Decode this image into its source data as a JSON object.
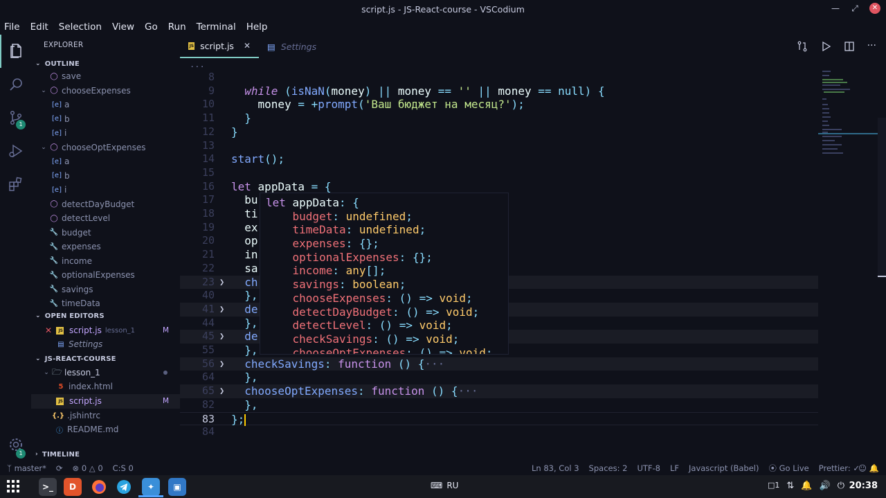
{
  "window": {
    "title": "script.js - JS-React-course - VSCodium"
  },
  "menu": [
    "File",
    "Edit",
    "Selection",
    "View",
    "Go",
    "Run",
    "Terminal",
    "Help"
  ],
  "activity": {
    "scm_badge": "1",
    "settings_badge": "1"
  },
  "sidebar": {
    "title": "EXPLORER",
    "outline_label": "OUTLINE",
    "outline_items": [
      {
        "label": "save",
        "kind": "method",
        "indent": 1
      },
      {
        "label": "chooseExpenses",
        "kind": "method",
        "indent": 1,
        "arrow": true
      },
      {
        "label": "a",
        "kind": "var",
        "indent": 2
      },
      {
        "label": "b",
        "kind": "var",
        "indent": 2
      },
      {
        "label": "i",
        "kind": "var",
        "indent": 2
      },
      {
        "label": "chooseOptExpenses",
        "kind": "method",
        "indent": 1,
        "arrow": true
      },
      {
        "label": "a",
        "kind": "var",
        "indent": 2
      },
      {
        "label": "b",
        "kind": "var",
        "indent": 2
      },
      {
        "label": "i",
        "kind": "var",
        "indent": 2
      },
      {
        "label": "detectDayBudget",
        "kind": "method",
        "indent": 1
      },
      {
        "label": "detectLevel",
        "kind": "method",
        "indent": 1
      },
      {
        "label": "budget",
        "kind": "prop",
        "indent": 1
      },
      {
        "label": "expenses",
        "kind": "prop",
        "indent": 1
      },
      {
        "label": "income",
        "kind": "prop",
        "indent": 1
      },
      {
        "label": "optionalExpenses",
        "kind": "prop",
        "indent": 1
      },
      {
        "label": "savings",
        "kind": "prop",
        "indent": 1
      },
      {
        "label": "timeData",
        "kind": "prop",
        "indent": 1
      }
    ],
    "open_editors_label": "OPEN EDITORS",
    "open_editors": [
      {
        "label": "script.js",
        "sub": "lesson_1",
        "flag": "M"
      },
      {
        "label": "Settings"
      }
    ],
    "project_label": "JS-REACT-COURSE",
    "files": [
      {
        "label": "lesson_1",
        "kind": "folder"
      },
      {
        "label": "index.html",
        "kind": "html"
      },
      {
        "label": "script.js",
        "kind": "js",
        "flag": "M"
      },
      {
        "label": ".jshintrc",
        "kind": "json"
      },
      {
        "label": "README.md",
        "kind": "info"
      }
    ],
    "timeline_label": "TIMELINE"
  },
  "tabs": [
    {
      "label": "script.js",
      "active": true
    },
    {
      "label": "Settings",
      "active": false
    }
  ],
  "editor": {
    "top_fold": "...",
    "lines": [
      {
        "n": "8",
        "html": ""
      },
      {
        "n": "9",
        "html": "  <span class=\"kwi\">while</span> <span class=\"op\">(</span><span class=\"fn\">isNaN</span><span class=\"op\">(</span><span class=\"var\">money</span><span class=\"op\">)</span> <span class=\"op\">||</span> <span class=\"var\">money</span> <span class=\"op\">==</span> <span class=\"str\">''</span> <span class=\"op\">||</span> <span class=\"var\">money</span> <span class=\"op\">==</span> <span class=\"op\">null)</span> <span class=\"op\">{</span>"
      },
      {
        "n": "10",
        "html": "    <span class=\"var\">money</span> <span class=\"op\">=</span> <span class=\"op\">+</span><span class=\"fn\">prompt</span><span class=\"op\">(</span><span class=\"str\">'Ваш бюджет на месяц?'</span><span class=\"op\">);</span>"
      },
      {
        "n": "11",
        "html": "  <span class=\"op\">}</span>"
      },
      {
        "n": "12",
        "html": "<span class=\"op\">}</span>"
      },
      {
        "n": "13",
        "html": ""
      },
      {
        "n": "14",
        "html": "<span class=\"fn\">start</span><span class=\"op\">();</span>"
      },
      {
        "n": "15",
        "html": ""
      },
      {
        "n": "16",
        "html": "<span class=\"kw\">let</span> <span class=\"var\">appData</span> <span class=\"op\">=</span> <span class=\"op\">{</span>"
      },
      {
        "n": "17",
        "html": "  <span class=\"var\">bu</span>"
      },
      {
        "n": "18",
        "html": "  <span class=\"var\">ti</span>"
      },
      {
        "n": "19",
        "html": "  <span class=\"var\">ex</span>"
      },
      {
        "n": "20",
        "html": "  <span class=\"var\">op</span>"
      },
      {
        "n": "21",
        "html": "  <span class=\"var\">in</span>"
      },
      {
        "n": "22",
        "html": "  <span class=\"var\">sa</span>"
      },
      {
        "n": "23",
        "html": "  <span class=\"fn\">ch</span>",
        "fold": true
      },
      {
        "n": "40",
        "html": "  <span class=\"op\">},</span>"
      },
      {
        "n": "41",
        "html": "  <span class=\"fn\">de</span>",
        "fold": true
      },
      {
        "n": "44",
        "html": "  <span class=\"op\">},</span>"
      },
      {
        "n": "45",
        "html": "  <span class=\"fn\">de</span>",
        "fold": true
      },
      {
        "n": "55",
        "html": "  <span class=\"op\">},</span>"
      },
      {
        "n": "56",
        "html": "  <span class=\"fn\">checkSavings</span><span class=\"op\">:</span> <span class=\"kw\">function</span> <span class=\"op\">()</span> <span class=\"op\">{</span><span class=\"cm\">···</span>",
        "fold": true
      },
      {
        "n": "64",
        "html": "  <span class=\"op\">},</span>"
      },
      {
        "n": "65",
        "html": "  <span class=\"fn\">chooseOptExpenses</span><span class=\"op\">:</span> <span class=\"kw\">function</span> <span class=\"op\">()</span> <span class=\"op\">{</span><span class=\"cm\">···</span>",
        "fold": true
      },
      {
        "n": "82",
        "html": "  <span class=\"op\">},</span>"
      },
      {
        "n": "83",
        "html": "<span class=\"op\">};</span><span class=\"cursor\"></span>",
        "current": true
      },
      {
        "n": "84",
        "html": ""
      }
    ]
  },
  "hover": {
    "lines": [
      "<span class=\"kw\">let</span> <span class=\"var\">appData</span><span class=\"op\">:</span> <span class=\"op\">{</span>",
      "    <span class=\"prop\">budget</span><span class=\"op\">:</span> <span class=\"type\">undefined</span><span class=\"op\">;</span>",
      "    <span class=\"prop\">timeData</span><span class=\"op\">:</span> <span class=\"type\">undefined</span><span class=\"op\">;</span>",
      "    <span class=\"prop\">expenses</span><span class=\"op\">:</span> <span class=\"op\">{};</span>",
      "    <span class=\"prop\">optionalExpenses</span><span class=\"op\">:</span> <span class=\"op\">{};</span>",
      "    <span class=\"prop\">income</span><span class=\"op\">:</span> <span class=\"type\">any</span><span class=\"op\">[];</span>",
      "    <span class=\"prop\">savings</span><span class=\"op\">:</span> <span class=\"type\">boolean</span><span class=\"op\">;</span>",
      "    <span class=\"prop\">chooseExpenses</span><span class=\"op\">:</span> <span class=\"op\">()</span> <span class=\"op\">=&gt;</span> <span class=\"type\">void</span><span class=\"op\">;</span>",
      "    <span class=\"prop\">detectDayBudget</span><span class=\"op\">:</span> <span class=\"op\">()</span> <span class=\"op\">=&gt;</span> <span class=\"type\">void</span><span class=\"op\">;</span>",
      "    <span class=\"prop\">detectLevel</span><span class=\"op\">:</span> <span class=\"op\">()</span> <span class=\"op\">=&gt;</span> <span class=\"type\">void</span><span class=\"op\">;</span>",
      "    <span class=\"prop\">checkSavings</span><span class=\"op\">:</span> <span class=\"op\">()</span> <span class=\"op\">=&gt;</span> <span class=\"type\">void</span><span class=\"op\">;</span>",
      "    <span class=\"prop\">chooseOptExpenses</span><span class=\"op\">:</span> <span class=\"op\">()</span> <span class=\"op\">=&gt;</span> <span class=\"type\">void</span><span class=\"op\">;</span>"
    ]
  },
  "status": {
    "branch": "master*",
    "errors": "0",
    "warnings": "0",
    "extra": "C:S 0",
    "position": "Ln 83, Col 3",
    "spaces": "Spaces: 2",
    "encoding": "UTF-8",
    "eol": "LF",
    "language": "Javascript (Babel)",
    "golive": "Go Live",
    "prettier": "Prettier: ✓"
  },
  "taskbar": {
    "keyboard": "RU",
    "clock": "20:38",
    "workspace_indicator": "1"
  },
  "colors": {
    "accent": "#80cbc4",
    "background": "#0f111a",
    "badge": "#1e8a73"
  }
}
